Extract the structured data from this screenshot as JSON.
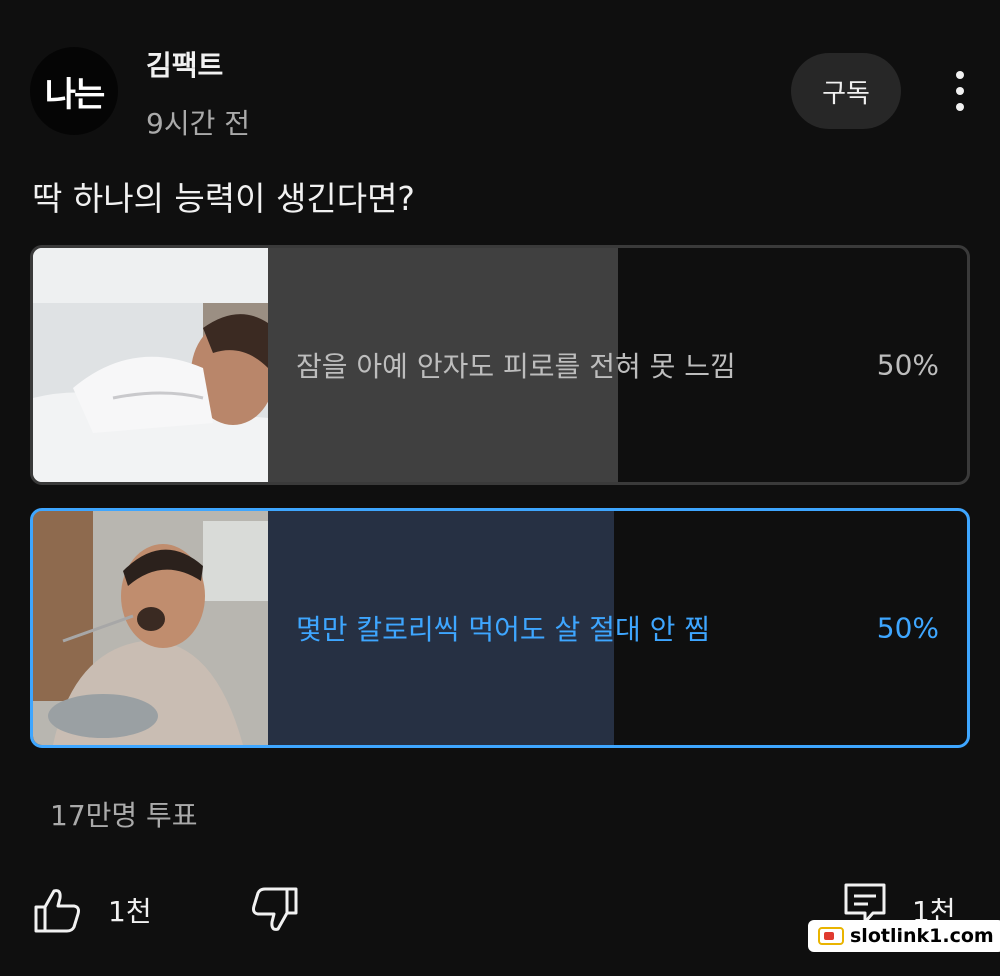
{
  "channel": {
    "avatar_text": "나는",
    "name": "김팩트",
    "time": "9시간 전",
    "subscribe_label": "구독"
  },
  "poll": {
    "question": "딱 하나의 능력이 생긴다면?",
    "options": [
      {
        "label": "잠을 아예 안자도 피로를 전혀 못 느낌",
        "percent_text": "50%",
        "percent": 50,
        "selected": false
      },
      {
        "label": "몇만 칼로리씩 먹어도 살 절대 안 찜",
        "percent_text": "50%",
        "percent": 50,
        "selected": true
      }
    ],
    "vote_count": "17만명 투표"
  },
  "actions": {
    "like_count": "1천",
    "comment_count": "1천"
  },
  "colors": {
    "background": "#0f0f0f",
    "accent": "#3ea6ff",
    "selected_fill": "#263043",
    "unselected_fill": "#404040"
  },
  "watermark": "slotlink1.com"
}
